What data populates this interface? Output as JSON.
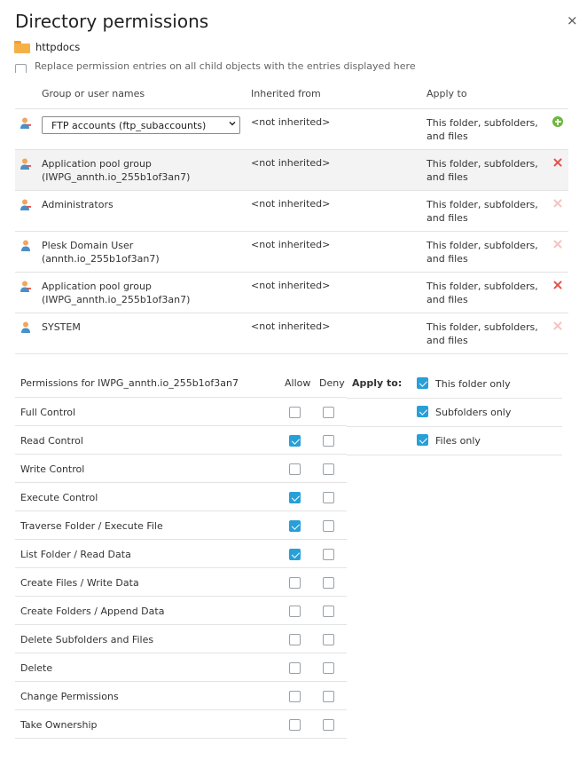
{
  "dialog": {
    "title": "Directory permissions",
    "close_label": "×"
  },
  "folder": {
    "name": "httpdocs"
  },
  "replace_option": {
    "label": "Replace permission entries on all child objects with the entries displayed here",
    "checked": false
  },
  "users_table": {
    "headers": {
      "name": "Group or user names",
      "inherited": "Inherited from",
      "apply": "Apply to"
    },
    "new_entry": {
      "select_value": "FTP accounts (ftp_subaccounts)",
      "inherited": "<not inherited>",
      "apply_line1": "This folder, subfolders,",
      "apply_line2": "and files",
      "icon": "user-add-icon",
      "action_icon": "add-icon"
    },
    "rows": [
      {
        "name_line1": "Application pool group",
        "name_line2": "(IWPG_annth.io_255b1of3an7)",
        "inherited": "<not inherited>",
        "apply_line1": "This folder, subfolders,",
        "apply_line2": "and files",
        "icon": "group-icon",
        "remove": "active",
        "selected": true
      },
      {
        "name_line1": "Administrators",
        "name_line2": "",
        "inherited": "<not inherited>",
        "apply_line1": "This folder, subfolders,",
        "apply_line2": "and files",
        "icon": "group-icon",
        "remove": "faded",
        "selected": false
      },
      {
        "name_line1": "Plesk Domain User (annth.io_255b1of3an7)",
        "name_line2": "",
        "inherited": "<not inherited>",
        "apply_line1": "This folder, subfolders,",
        "apply_line2": "and files",
        "icon": "user-icon",
        "remove": "faded",
        "selected": false
      },
      {
        "name_line1": "Application pool group",
        "name_line2": "(IWPG_annth.io_255b1of3an7)",
        "inherited": "<not inherited>",
        "apply_line1": "This folder, subfolders,",
        "apply_line2": "and files",
        "icon": "group-icon",
        "remove": "active",
        "selected": false
      },
      {
        "name_line1": "SYSTEM",
        "name_line2": "",
        "inherited": "<not inherited>",
        "apply_line1": "This folder, subfolders,",
        "apply_line2": "and files",
        "icon": "user-icon",
        "remove": "faded",
        "selected": false
      }
    ]
  },
  "permissions": {
    "title": "Permissions for IWPG_annth.io_255b1of3an7",
    "allow_label": "Allow",
    "deny_label": "Deny",
    "rows": [
      {
        "label": "Full Control",
        "allow": false,
        "deny": false
      },
      {
        "label": "Read Control",
        "allow": true,
        "deny": false
      },
      {
        "label": "Write Control",
        "allow": false,
        "deny": false
      },
      {
        "label": "Execute Control",
        "allow": true,
        "deny": false
      },
      {
        "label": "Traverse Folder / Execute File",
        "allow": true,
        "deny": false
      },
      {
        "label": "List Folder / Read Data",
        "allow": true,
        "deny": false
      },
      {
        "label": "Create Files / Write Data",
        "allow": false,
        "deny": false
      },
      {
        "label": "Create Folders / Append Data",
        "allow": false,
        "deny": false
      },
      {
        "label": "Delete Subfolders and Files",
        "allow": false,
        "deny": false
      },
      {
        "label": "Delete",
        "allow": false,
        "deny": false
      },
      {
        "label": "Change Permissions",
        "allow": false,
        "deny": false
      },
      {
        "label": "Take Ownership",
        "allow": false,
        "deny": false
      }
    ]
  },
  "apply_to": {
    "label": "Apply to:",
    "options": [
      {
        "label": "This folder only",
        "checked": true
      },
      {
        "label": "Subfolders only",
        "checked": true
      },
      {
        "label": "Files only",
        "checked": true
      }
    ]
  },
  "colors": {
    "checkbox_on": "#289fd8",
    "remove_active": "#e4514a",
    "remove_faded": "#f5c2c0",
    "add": "#6ab839",
    "folder": "#f6b146"
  }
}
